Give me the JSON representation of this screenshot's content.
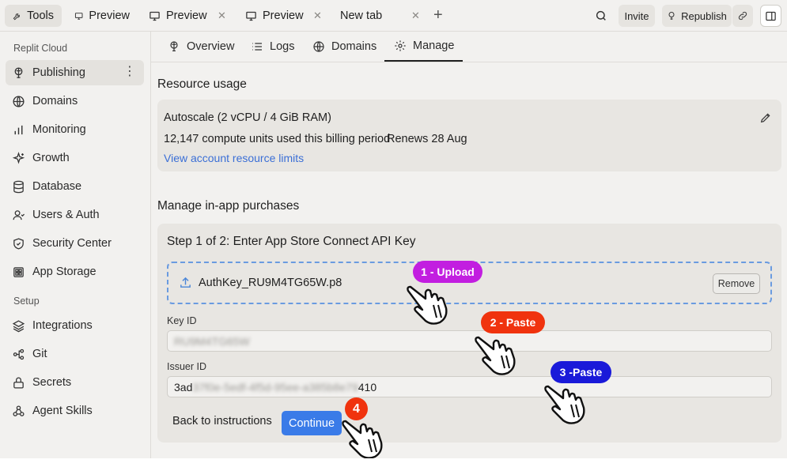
{
  "topbar": {
    "tabs": [
      {
        "label": "Tools",
        "icon": "wrench-icon"
      },
      {
        "label": "Preview",
        "icon": "monitor-icon"
      },
      {
        "label": "Preview",
        "icon": "monitor-icon"
      },
      {
        "label": "Preview",
        "icon": "monitor-icon"
      },
      {
        "label": "New tab"
      }
    ],
    "invite_label": "Invite",
    "republish_label": "Republish"
  },
  "sidebar": {
    "section_cloud": "Replit Cloud",
    "section_setup": "Setup",
    "items": [
      {
        "label": "Publishing",
        "icon": "publish-icon",
        "active": true
      },
      {
        "label": "Domains",
        "icon": "globe-icon"
      },
      {
        "label": "Monitoring",
        "icon": "bar-chart-icon"
      },
      {
        "label": "Growth",
        "icon": "sparkle-icon"
      },
      {
        "label": "Database",
        "icon": "database-icon"
      },
      {
        "label": "Users & Auth",
        "icon": "user-icon"
      },
      {
        "label": "Security Center",
        "icon": "shield-icon"
      },
      {
        "label": "App Storage",
        "icon": "storage-icon"
      }
    ],
    "setup_items": [
      {
        "label": "Integrations",
        "icon": "layers-icon"
      },
      {
        "label": "Git",
        "icon": "git-icon"
      },
      {
        "label": "Secrets",
        "icon": "lock-icon"
      },
      {
        "label": "Agent Skills",
        "icon": "skills-icon"
      }
    ]
  },
  "subtabs": [
    {
      "label": "Overview",
      "icon": "publish-icon"
    },
    {
      "label": "Logs",
      "icon": "list-icon"
    },
    {
      "label": "Domains",
      "icon": "globe-icon"
    },
    {
      "label": "Manage",
      "icon": "gear-icon",
      "active": true
    }
  ],
  "resource_usage": {
    "title": "Resource usage",
    "plan": "Autoscale (2 vCPU / 4 GiB RAM)",
    "units": "12,147 compute units used this billing period",
    "renews": "Renews 28 Aug",
    "limits_link": "View account resource limits"
  },
  "purchases": {
    "title": "Manage in-app purchases",
    "step_title": "Step 1 of 2: Enter App Store Connect API Key",
    "file_name": "AuthKey_RU9M4TG65W.p8",
    "remove_label": "Remove",
    "key_id_label": "Key ID",
    "key_id_value": "RU9M4TG65W",
    "issuer_id_label": "Issuer ID",
    "issuer_prefix": "3ad",
    "issuer_hidden": "37f0e-5edf-4f5d-95ee-a385b8e79",
    "issuer_suffix": "410",
    "back_label": "Back to instructions",
    "continue_label": "Continue"
  },
  "annotations": {
    "upload": "1 - Upload",
    "paste1": "2 - Paste",
    "paste2": "3 -Paste",
    "step4": "4",
    "colors": {
      "upload": "#c21ee0",
      "paste1": "#f0330e",
      "paste2": "#1a1ad9",
      "step4": "#f0330e"
    }
  },
  "colors": {
    "accent": "#3a7be8",
    "link": "#3b6fd6",
    "dashed_border": "#6a9be0"
  }
}
